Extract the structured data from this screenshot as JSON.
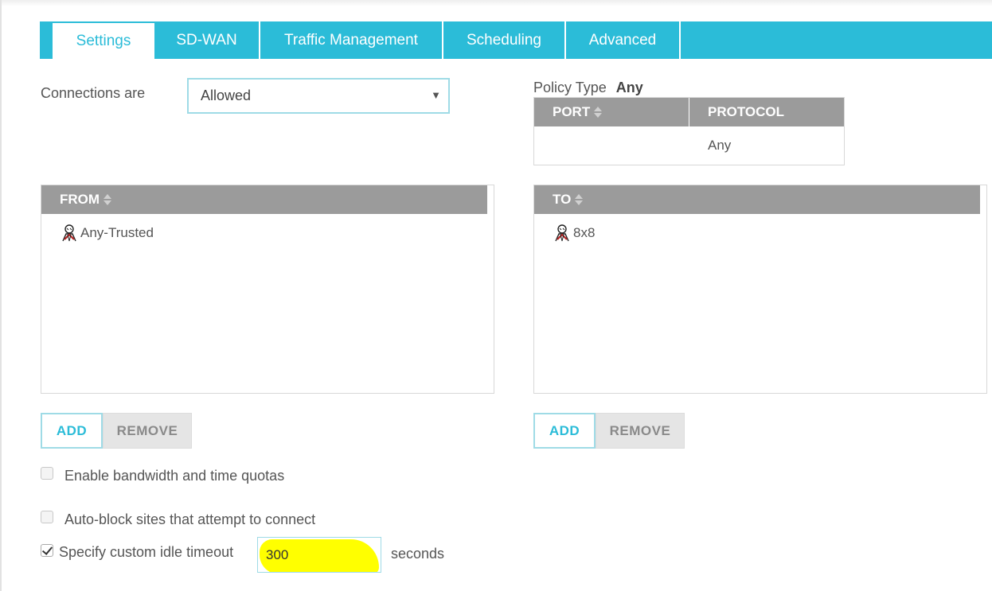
{
  "tabs": [
    {
      "label": "Settings",
      "active": true
    },
    {
      "label": "SD-WAN",
      "active": false
    },
    {
      "label": "Traffic Management",
      "active": false
    },
    {
      "label": "Scheduling",
      "active": false
    },
    {
      "label": "Advanced",
      "active": false
    }
  ],
  "connections": {
    "label": "Connections are",
    "selected": "Allowed"
  },
  "policy": {
    "type_label": "Policy Type",
    "type_value": "Any",
    "columns": {
      "port": "PORT",
      "protocol": "PROTOCOL"
    },
    "rows": [
      {
        "port": "",
        "protocol": "Any"
      }
    ]
  },
  "from_panel": {
    "header": "FROM",
    "items": [
      "Any-Trusted"
    ],
    "add_label": "ADD",
    "remove_label": "REMOVE"
  },
  "to_panel": {
    "header": "TO",
    "items": [
      "8x8"
    ],
    "add_label": "ADD",
    "remove_label": "REMOVE"
  },
  "options": {
    "bandwidth": {
      "label": "Enable bandwidth and time quotas",
      "checked": false
    },
    "autoblock": {
      "label": "Auto-block sites that attempt to connect",
      "checked": false
    },
    "idle": {
      "label": "Specify custom idle timeout",
      "checked": true,
      "value": "300",
      "unit": "seconds"
    }
  },
  "colors": {
    "accent": "#2bbcd8",
    "header_gray": "#9b9b9b",
    "highlight": "#ffff00"
  }
}
